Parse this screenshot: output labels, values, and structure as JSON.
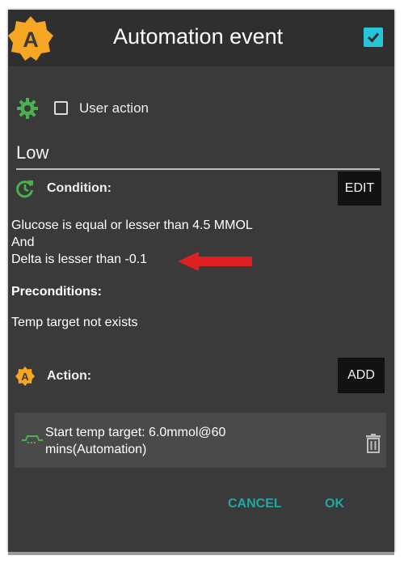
{
  "dialog": {
    "title": "Automation event",
    "app_icon_letter": "A",
    "title_checkbox_checked": true
  },
  "user_action": {
    "checked": false,
    "label": "User action"
  },
  "name_field": {
    "value": "Low"
  },
  "condition": {
    "label": "Condition:",
    "edit_button": "EDIT",
    "lines": [
      "Glucose is equal or lesser than 4.5 MMOL",
      "And",
      "Delta is lesser than -0.1"
    ]
  },
  "preconditions": {
    "label": "Preconditions:",
    "lines": [
      "Temp target not exists"
    ]
  },
  "action": {
    "label": "Action:",
    "icon_letter": "A",
    "add_button": "ADD",
    "items": [
      {
        "text": "Start temp target: 6.0mmol@60 mins(Automation)",
        "icon": "temp-target-icon"
      }
    ]
  },
  "footer": {
    "cancel": "CANCEL",
    "ok": "OK"
  },
  "colors": {
    "dialog_bg": "#3a3a3a",
    "titlebar_bg": "#2f2f2f",
    "accent": "#26c6da",
    "button_text": "#1fa8a4",
    "green_icon": "#4caf50",
    "orange_icon": "#f5a623",
    "highlight_arrow": "#e02020"
  },
  "icons": {
    "app": "automation-app-icon",
    "gear": "gear-icon",
    "condition": "refresh-icon",
    "action": "automation-action-icon",
    "trash": "trash-icon",
    "annotation": "red-arrow-icon"
  }
}
